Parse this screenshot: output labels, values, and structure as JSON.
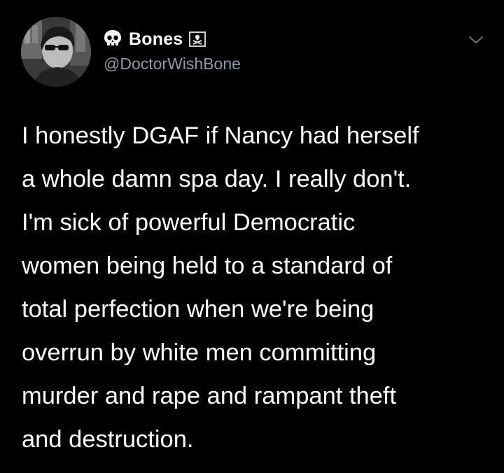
{
  "author": {
    "display_name": "Bones",
    "handle": "@DoctorWishBone",
    "name_prefix_icon": "skull-icon",
    "name_suffix_icon": "pirate-flag-icon"
  },
  "menu_icon": "chevron-down-icon",
  "tweet": {
    "paragraph_1": [
      "I honestly DGAF if Nancy had herself",
      "a whole damn spa day. I really don't."
    ],
    "paragraph_2": [
      "I'm sick of powerful Democratic",
      "women being held to a standard of",
      "total perfection when we're being",
      "overrun by white men committing",
      "murder and rape and rampant theft",
      "and destruction."
    ]
  },
  "colors": {
    "background": "#000000",
    "text_primary": "#ffffff",
    "text_secondary": "#8b98a5"
  }
}
